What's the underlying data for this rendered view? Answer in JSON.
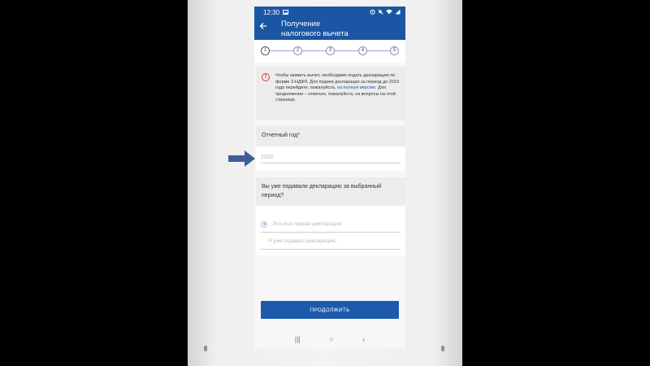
{
  "status_bar": {
    "time": "12:30",
    "left_icons": [
      "image-icon"
    ],
    "right_icons": [
      "alarm-icon",
      "mute-icon",
      "wifi-icon",
      "signal-icon"
    ]
  },
  "header": {
    "back_icon": "arrow-left-icon",
    "title_line1": "Получение",
    "title_line2": "налогового вычета"
  },
  "stepper": {
    "steps": [
      "1",
      "2",
      "3",
      "4",
      "5"
    ],
    "current": 1
  },
  "info": {
    "icon": "alert-circle-icon",
    "text_before_link": "Чтобы заявить вычет, необходимо подать декларацию по форме 3-НДФЛ. Для подачи декларации за период до 2019 года перейдите, пожалуйста, ",
    "link_text": "на полную версию",
    "text_after_link": ". Для продолжения – ответьте, пожалуйста, на вопросы на этой странице."
  },
  "year": {
    "label": "Отчетный год*",
    "placeholder": "2020"
  },
  "declaration": {
    "question": "Вы уже подавали декларацию за выбранный период?",
    "options": [
      "Это моя первая декларация",
      "Я уже подавал декларацию"
    ],
    "selected_index": 0
  },
  "continue_label": "ПРОДОЛЖИТЬ",
  "nav_bar": {
    "recent_icon": "|||",
    "home_icon": "○",
    "back_icon": "‹"
  },
  "colors": {
    "primary": "#1b56a4",
    "alert": "#d23a3a",
    "annotation_arrow": "#3f5e96"
  }
}
